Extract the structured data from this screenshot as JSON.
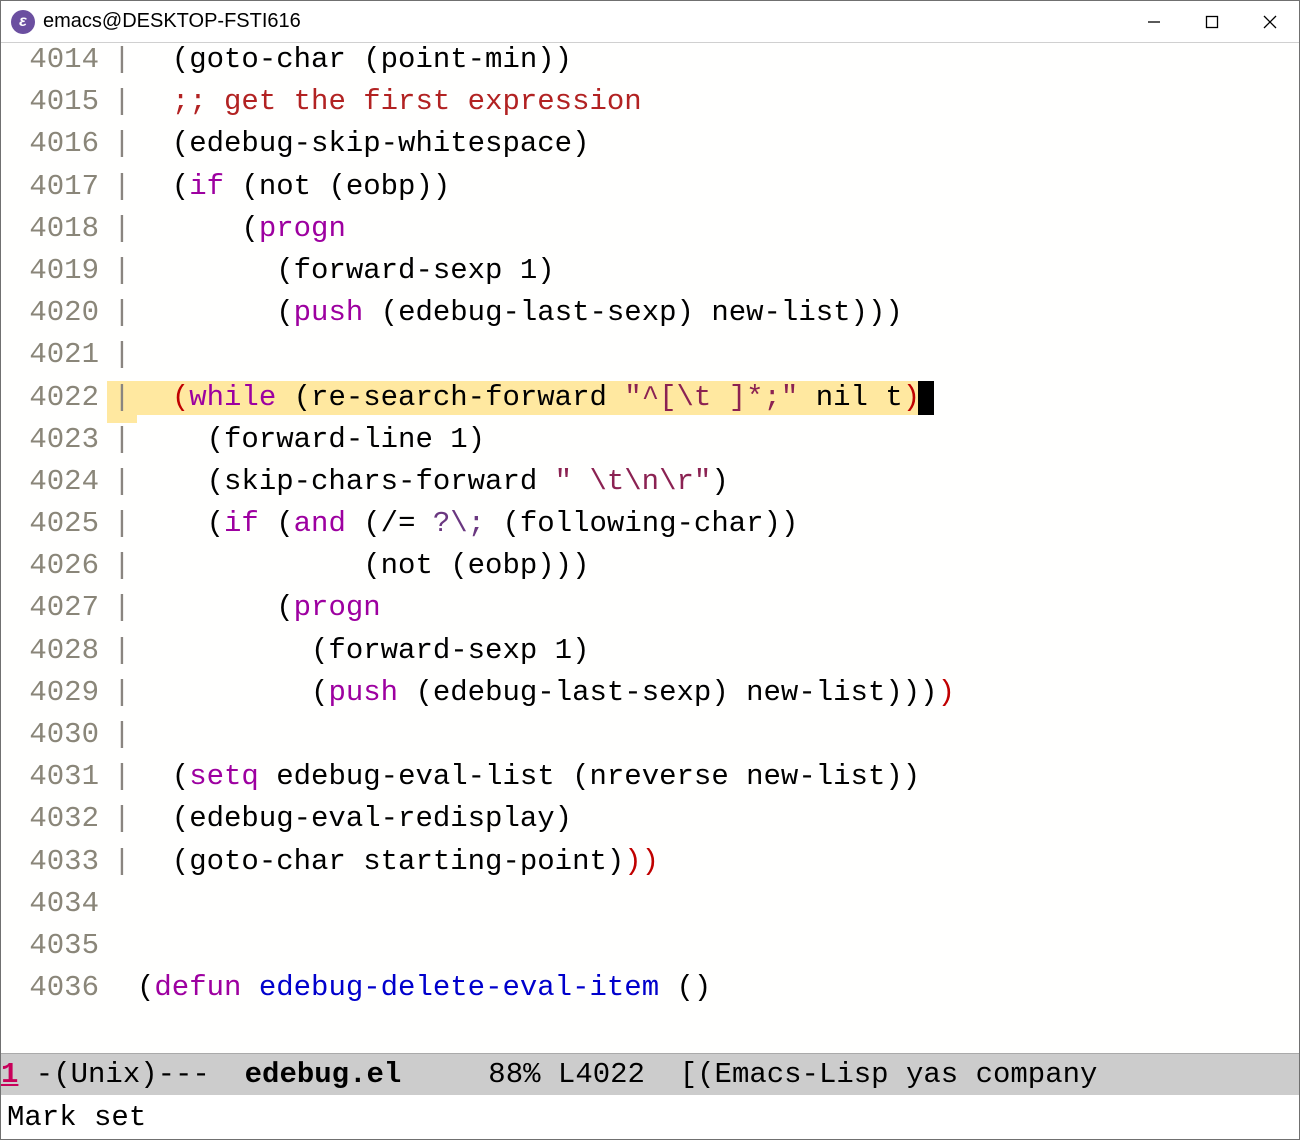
{
  "window": {
    "title": "emacs@DESKTOP-FSTI616"
  },
  "gutter_bar": "|",
  "lines": [
    {
      "num": "4014",
      "bar": true,
      "tokens": [
        {
          "t": "  (goto-char (point-min))",
          "c": ""
        }
      ]
    },
    {
      "num": "4015",
      "bar": true,
      "tokens": [
        {
          "t": "  ",
          "c": ""
        },
        {
          "t": ";; get the first expression",
          "c": "cmt"
        }
      ]
    },
    {
      "num": "4016",
      "bar": true,
      "tokens": [
        {
          "t": "  (edebug-skip-whitespace)",
          "c": ""
        }
      ]
    },
    {
      "num": "4017",
      "bar": true,
      "tokens": [
        {
          "t": "  (",
          "c": ""
        },
        {
          "t": "if",
          "c": "kw"
        },
        {
          "t": " (not (eobp))",
          "c": ""
        }
      ]
    },
    {
      "num": "4018",
      "bar": true,
      "tokens": [
        {
          "t": "      (",
          "c": ""
        },
        {
          "t": "progn",
          "c": "kw"
        }
      ]
    },
    {
      "num": "4019",
      "bar": true,
      "tokens": [
        {
          "t": "        (forward-sexp 1)",
          "c": ""
        }
      ]
    },
    {
      "num": "4020",
      "bar": true,
      "tokens": [
        {
          "t": "        (",
          "c": ""
        },
        {
          "t": "push",
          "c": "kw"
        },
        {
          "t": " (edebug-last-sexp) new-list)))",
          "c": ""
        }
      ]
    },
    {
      "num": "4021",
      "bar": true,
      "tokens": []
    },
    {
      "num": "4022",
      "bar": true,
      "hl": true,
      "tokens": [
        {
          "t": "  ",
          "c": ""
        },
        {
          "t": "(",
          "c": "paren-red"
        },
        {
          "t": "while",
          "c": "kw"
        },
        {
          "t": " (re-search-forward ",
          "c": ""
        },
        {
          "t": "\"^[\\t ]*;\"",
          "c": "str"
        },
        {
          "t": " nil t",
          "c": ""
        },
        {
          "t": ")",
          "c": "paren-red"
        }
      ],
      "cursor": true
    },
    {
      "num": "4023",
      "bar": true,
      "tokens": [
        {
          "t": "    (forward-line 1)",
          "c": ""
        }
      ]
    },
    {
      "num": "4024",
      "bar": true,
      "tokens": [
        {
          "t": "    (skip-chars-forward ",
          "c": ""
        },
        {
          "t": "\" \\t\\n\\r\"",
          "c": "str"
        },
        {
          "t": ")",
          "c": ""
        }
      ]
    },
    {
      "num": "4025",
      "bar": true,
      "tokens": [
        {
          "t": "    (",
          "c": ""
        },
        {
          "t": "if",
          "c": "kw"
        },
        {
          "t": " (",
          "c": ""
        },
        {
          "t": "and",
          "c": "kw"
        },
        {
          "t": " (/= ",
          "c": ""
        },
        {
          "t": "?\\;",
          "c": "const"
        },
        {
          "t": " (following-char))",
          "c": ""
        }
      ]
    },
    {
      "num": "4026",
      "bar": true,
      "tokens": [
        {
          "t": "             (not (eobp)))",
          "c": ""
        }
      ]
    },
    {
      "num": "4027",
      "bar": true,
      "tokens": [
        {
          "t": "        (",
          "c": ""
        },
        {
          "t": "progn",
          "c": "kw"
        }
      ]
    },
    {
      "num": "4028",
      "bar": true,
      "tokens": [
        {
          "t": "          (forward-sexp 1)",
          "c": ""
        }
      ]
    },
    {
      "num": "4029",
      "bar": true,
      "tokens": [
        {
          "t": "          (",
          "c": ""
        },
        {
          "t": "push",
          "c": "kw"
        },
        {
          "t": " (edebug-last-sexp) new-list)))",
          "c": ""
        },
        {
          "t": ")",
          "c": "paren-red"
        }
      ]
    },
    {
      "num": "4030",
      "bar": true,
      "tokens": []
    },
    {
      "num": "4031",
      "bar": true,
      "tokens": [
        {
          "t": "  (",
          "c": ""
        },
        {
          "t": "setq",
          "c": "kw"
        },
        {
          "t": " edebug-eval-list (nreverse new-list))",
          "c": ""
        }
      ]
    },
    {
      "num": "4032",
      "bar": true,
      "tokens": [
        {
          "t": "  (edebug-eval-redisplay)",
          "c": ""
        }
      ]
    },
    {
      "num": "4033",
      "bar": true,
      "tokens": [
        {
          "t": "  (goto-char starting-point)",
          "c": ""
        },
        {
          "t": "))",
          "c": "paren-red"
        }
      ]
    },
    {
      "num": "4034",
      "bar": false,
      "tokens": []
    },
    {
      "num": "4035",
      "bar": false,
      "tokens": []
    },
    {
      "num": "4036",
      "bar": false,
      "tokens": [
        {
          "t": "(",
          "c": ""
        },
        {
          "t": "defun",
          "c": "kw"
        },
        {
          "t": " ",
          "c": ""
        },
        {
          "t": "edebug-delete-eval-item",
          "c": "fn"
        },
        {
          "t": " ()",
          "c": ""
        }
      ]
    }
  ],
  "modeline": {
    "window_num": "1",
    "left": " -(Unix)---  ",
    "buffer": "edebug.el",
    "middle": "     88% L4022  [(Emacs-Lisp yas company"
  },
  "minibuffer": "Mark set"
}
